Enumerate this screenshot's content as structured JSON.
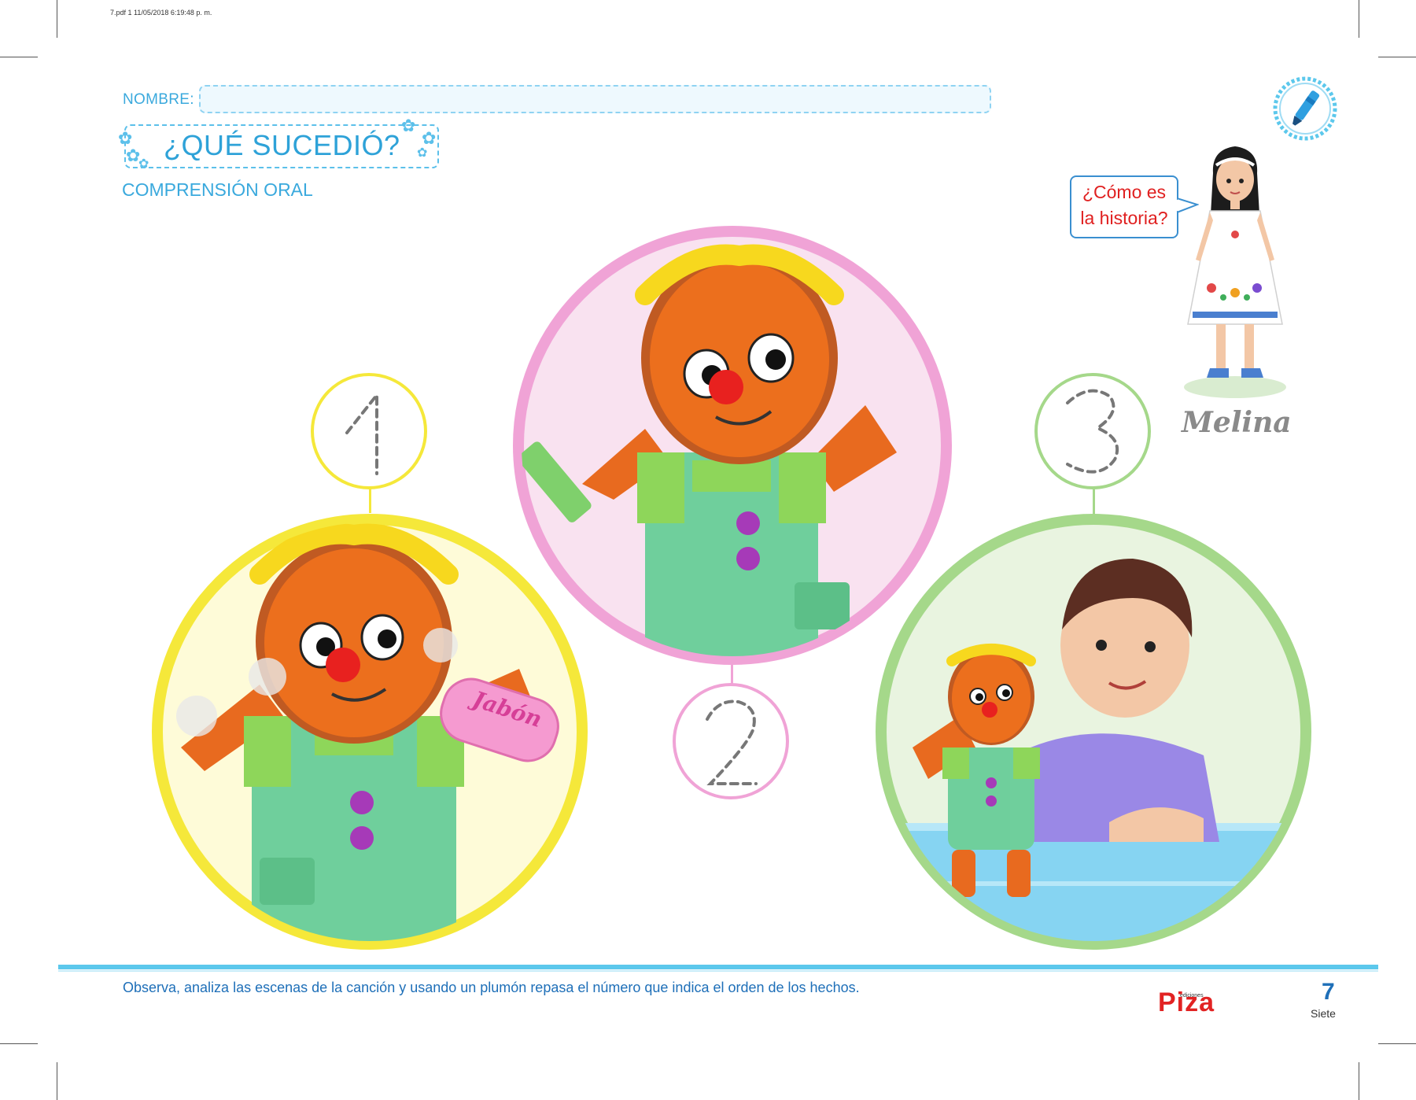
{
  "print_meta": "7.pdf   1   11/05/2018   6:19:48 p. m.",
  "header": {
    "name_label": "NOMBRE:",
    "title": "¿QUÉ SUCEDIÓ?",
    "subtitle": "COMPRENSIÓN ORAL"
  },
  "speech_bubble": {
    "line1": "¿Cómo es",
    "line2": "la historia?"
  },
  "character_name": "Melina",
  "scenes": [
    {
      "number": "1",
      "color": "#f5e83a",
      "label": "Jabón"
    },
    {
      "number": "2",
      "color": "#f0a3d6"
    },
    {
      "number": "3",
      "color": "#a5d88a"
    }
  ],
  "footer": {
    "instruction": "Observa, analiza las escenas de la canción y usando un plumón repasa el número que indica el orden de los hechos.",
    "brand_small": "ediciones",
    "brand": "Piza",
    "page_number": "7",
    "page_word": "Siete"
  },
  "colors": {
    "accent_blue": "#3aa9dd",
    "text_blue": "#1e6fb8",
    "brand_red": "#e22323",
    "bubble_text_red": "#e02020"
  }
}
